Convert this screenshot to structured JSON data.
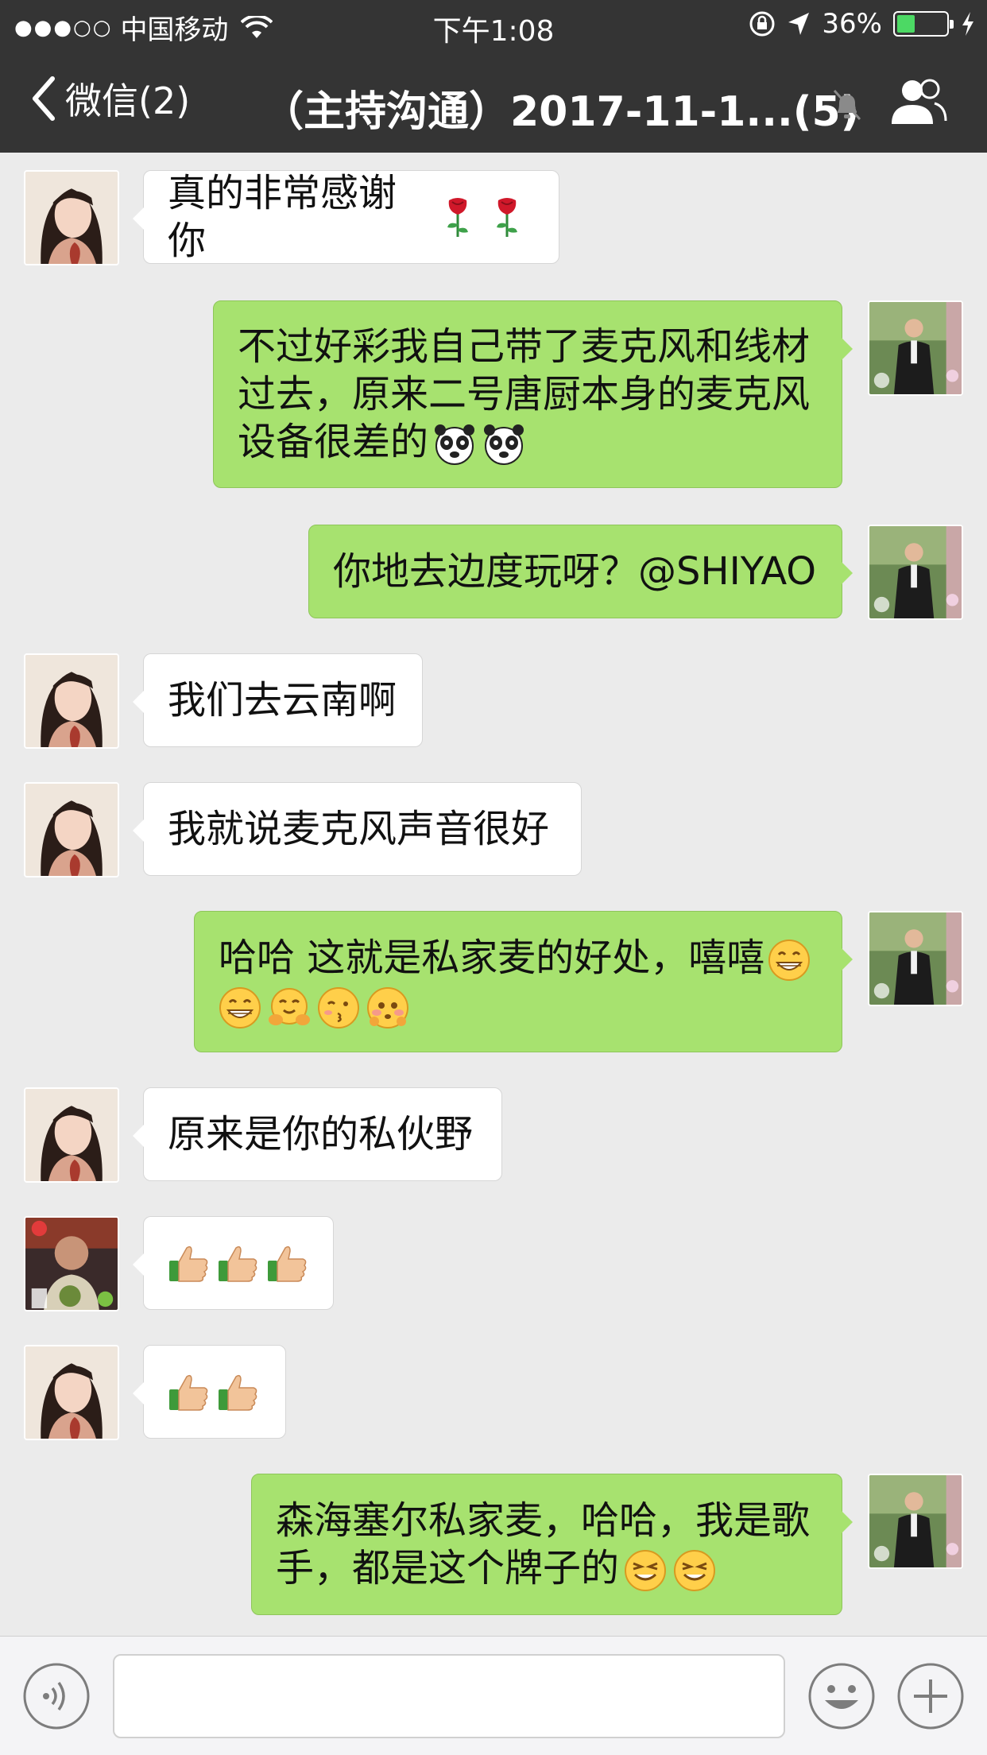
{
  "status_bar": {
    "signal": "●●●○○",
    "carrier": "中国移动",
    "time": "下午1:08",
    "battery_percent": "36%",
    "battery_level": 0.36
  },
  "nav": {
    "back_label": "微信(2)",
    "title": "（主持沟通）2017-11-1...(5)"
  },
  "messages": [
    {
      "side": "left",
      "sender": "female",
      "text": "真的非常感谢你",
      "emojis": [
        "rose-emoji",
        "rose-emoji"
      ]
    },
    {
      "side": "right",
      "sender": "self",
      "lines": [
        "不过好彩我自己带了麦克风和线材",
        "过去，原来二号唐厨本身的麦克风",
        "设备很差的"
      ],
      "emojis": [
        "panda-face-emoji",
        "panda-face-emoji"
      ]
    },
    {
      "side": "right",
      "sender": "self",
      "text": "你地去边度玩呀？@SHIYAO"
    },
    {
      "side": "left",
      "sender": "female",
      "text": "我们去云南啊"
    },
    {
      "side": "left",
      "sender": "female",
      "text": "我就说麦克风声音很好"
    },
    {
      "side": "right",
      "sender": "self",
      "lines": [
        "哈哈 这就是私家麦的好处，嘻嘻"
      ],
      "emojis": [
        "grin-emoji",
        "grin-emoji",
        "hug-emoji",
        "kiss-emoji",
        "shy-emoji"
      ]
    },
    {
      "side": "left",
      "sender": "female",
      "text": "原来是你的私伙野"
    },
    {
      "side": "left",
      "sender": "male",
      "emojis": [
        "thumbs-up-emoji",
        "thumbs-up-emoji",
        "thumbs-up-emoji"
      ]
    },
    {
      "side": "left",
      "sender": "female",
      "emojis": [
        "thumbs-up-emoji",
        "thumbs-up-emoji"
      ]
    },
    {
      "side": "right",
      "sender": "self",
      "lines": [
        "森海塞尔私家麦，哈哈，我是歌",
        "手，都是这个牌子的"
      ],
      "emojis": [
        "smirk-emoji",
        "smirk-emoji"
      ]
    }
  ],
  "input": {
    "value": "",
    "placeholder": ""
  },
  "colors": {
    "header_bg": "#343434",
    "chat_bg": "#ebebeb",
    "bubble_self": "#a7e26f",
    "bubble_other": "#ffffff",
    "battery_green": "#4cd964"
  }
}
